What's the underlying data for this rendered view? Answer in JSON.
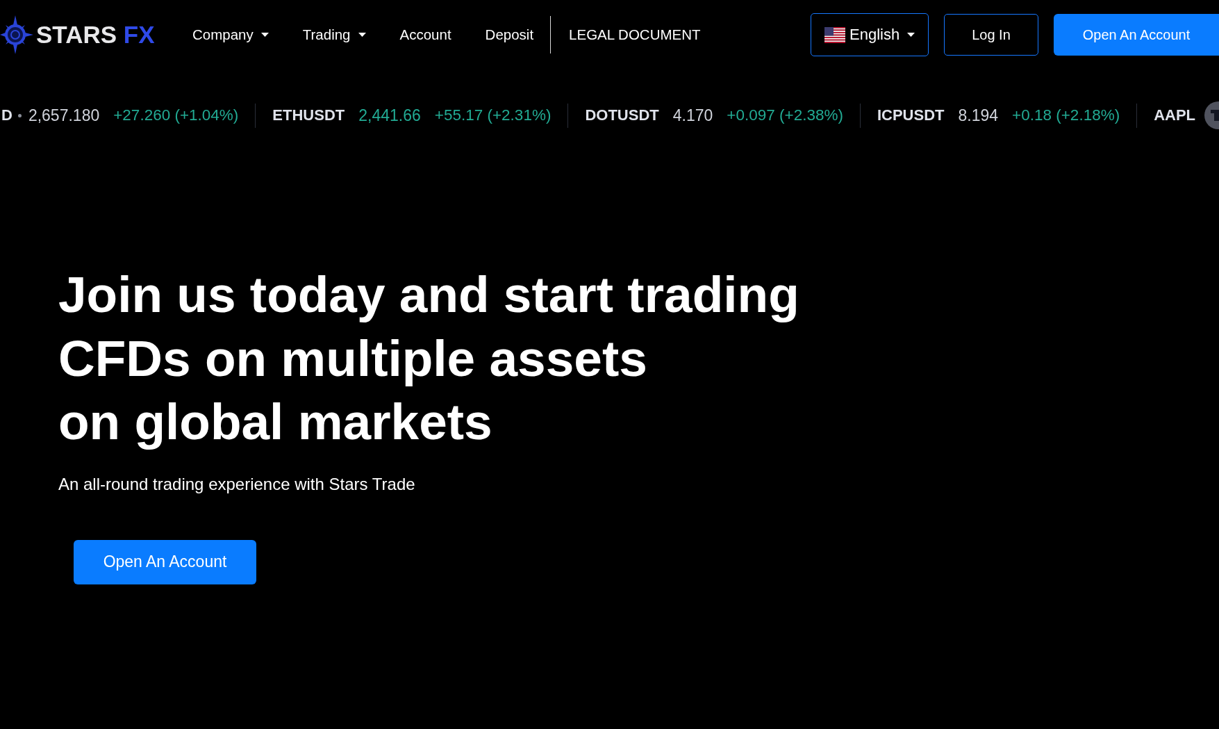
{
  "logo": {
    "name": "STARS",
    "accent": "FX"
  },
  "nav": [
    {
      "label": "Company",
      "has_menu": true,
      "divider_before": false
    },
    {
      "label": "Trading",
      "has_menu": true,
      "divider_before": false
    },
    {
      "label": "Account",
      "has_menu": false,
      "divider_before": false
    },
    {
      "label": "Deposit",
      "has_menu": false,
      "divider_before": false
    },
    {
      "label": "LEGAL DOCUMENT",
      "has_menu": false,
      "divider_before": true
    }
  ],
  "language": {
    "label": "English"
  },
  "login": {
    "label": "Log In"
  },
  "open_account": {
    "label": "Open An Account"
  },
  "ticker": [
    {
      "symbol": "D",
      "status_dot": true,
      "price": "2,657.180",
      "color": "#d1d4dc",
      "change": "+27.260 (+1.04%)"
    },
    {
      "symbol": "ETHUSDT",
      "status_dot": false,
      "price": "2,441.66",
      "color": "#22ab94",
      "change": "+55.17 (+2.31%)"
    },
    {
      "symbol": "DOTUSDT",
      "status_dot": false,
      "price": "4.170",
      "color": "#d1d4dc",
      "change": "+0.097 (+2.38%)"
    },
    {
      "symbol": "ICPUSDT",
      "status_dot": false,
      "price": "8.194",
      "color": "#d1d4dc",
      "change": "+0.18 (+2.18%)"
    },
    {
      "symbol": "AAPL",
      "status_dot": false
    }
  ],
  "hero": {
    "headline": [
      "Join us today and start trading",
      "CFDs on multiple assets",
      "on global markets"
    ],
    "subtitle": "An all-round trading experience with Stars Trade",
    "cta": "Open An Account"
  }
}
